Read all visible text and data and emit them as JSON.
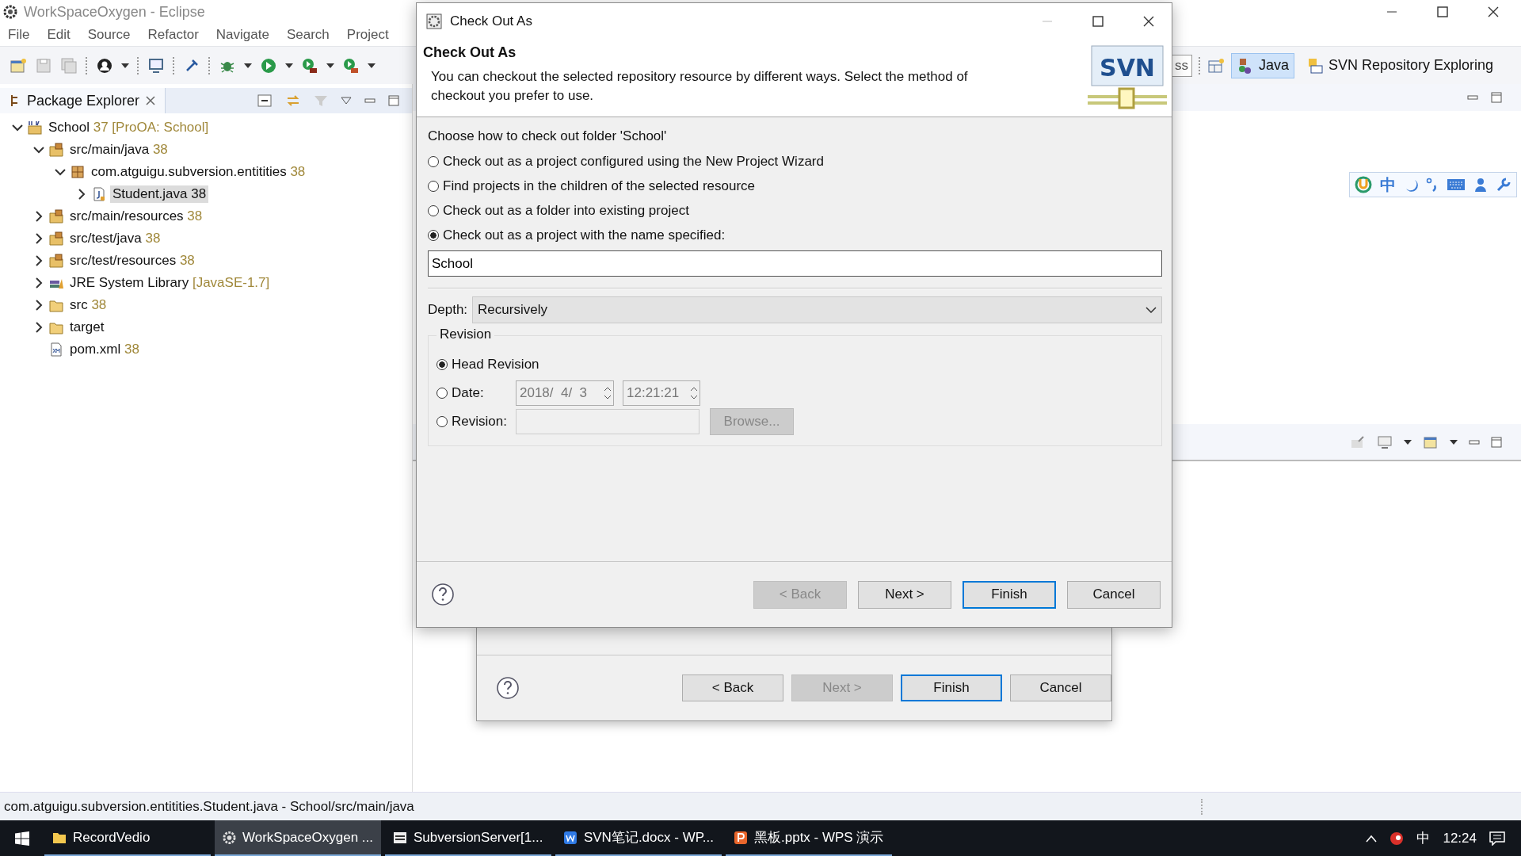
{
  "eclipse": {
    "title": "WorkSpaceOxygen - Eclipse",
    "menu": [
      "File",
      "Edit",
      "Source",
      "Refactor",
      "Navigate",
      "Search",
      "Project"
    ],
    "quick_access": "ss",
    "perspectives": [
      {
        "label": "Java",
        "selected": true,
        "kind": "java"
      },
      {
        "label": "SVN Repository Exploring",
        "selected": false,
        "kind": "svn"
      }
    ],
    "package_explorer": {
      "title": "Package Explorer",
      "tree": [
        {
          "label": "School",
          "decoration": "37 [ProOA: School]",
          "kind": "project",
          "expandable": true,
          "expanded": true,
          "selected": false,
          "children": [
            {
              "label": "src/main/java",
              "decoration": "38",
              "kind": "source-folder",
              "expandable": true,
              "expanded": true,
              "selected": false,
              "children": [
                {
                  "label": "com.atguigu.subversion.entitities",
                  "decoration": "38",
                  "kind": "package",
                  "expandable": true,
                  "expanded": true,
                  "selected": false,
                  "children": [
                    {
                      "label": "Student.java",
                      "decoration": "38",
                      "kind": "java-file",
                      "expandable": true,
                      "expanded": false,
                      "selected": true
                    }
                  ]
                }
              ]
            },
            {
              "label": "src/main/resources",
              "decoration": "38",
              "kind": "source-folder",
              "expandable": true,
              "expanded": false,
              "selected": false
            },
            {
              "label": "src/test/java",
              "decoration": "38",
              "kind": "source-folder",
              "expandable": true,
              "expanded": false,
              "selected": false
            },
            {
              "label": "src/test/resources",
              "decoration": "38",
              "kind": "source-folder",
              "expandable": true,
              "expanded": false,
              "selected": false
            },
            {
              "label": "JRE System Library",
              "decoration": "[JavaSE-1.7]",
              "kind": "library",
              "expandable": true,
              "expanded": false,
              "selected": false
            },
            {
              "label": "src",
              "decoration": "38",
              "kind": "folder",
              "expandable": true,
              "expanded": false,
              "selected": false
            },
            {
              "label": "target",
              "kind": "folder",
              "expandable": true,
              "expanded": false,
              "selected": false
            },
            {
              "label": "pom.xml",
              "decoration": "38",
              "kind": "xml-file",
              "expandable": false,
              "expanded": false,
              "selected": false
            }
          ]
        }
      ]
    },
    "status_bar": "com.atguigu.subversion.entitities.Student.java - School/src/main/java"
  },
  "dialog": {
    "title": "Check Out As",
    "heading": "Check Out As",
    "logo": "SVN",
    "description": "You can checkout the selected repository resource by different ways. Select the method of checkout you prefer to use.",
    "prompt": "Choose how to check out folder 'School'",
    "methods": [
      {
        "label": "Check out as a project configured using the New Project Wizard",
        "selected": false
      },
      {
        "label": "Find projects in the children of the selected resource",
        "selected": false
      },
      {
        "label": "Check out as a folder into existing project",
        "selected": false
      },
      {
        "label": "Check out as a project with the name specified:",
        "selected": true
      }
    ],
    "project_name": "School",
    "depth": {
      "label": "Depth:",
      "value": "Recursively"
    },
    "revision": {
      "title": "Revision",
      "options": [
        {
          "label": "Head Revision",
          "kind": "head",
          "selected": true
        },
        {
          "label": "Date:",
          "kind": "date",
          "selected": false,
          "date": "2018/  4/  3",
          "time": "12:21:21"
        },
        {
          "label": "Revision:",
          "kind": "number",
          "selected": false,
          "button": "Browse..."
        }
      ]
    },
    "buttons": [
      {
        "label": "< Back",
        "disabled": true,
        "default": false
      },
      {
        "label": "Next >",
        "disabled": false,
        "default": false
      },
      {
        "label": "Finish",
        "disabled": false,
        "default": true
      },
      {
        "label": "Cancel",
        "disabled": false,
        "default": false
      }
    ]
  },
  "back_dialog": {
    "buttons": [
      {
        "label": "< Back",
        "disabled": false,
        "default": false
      },
      {
        "label": "Next >",
        "disabled": true,
        "default": false
      },
      {
        "label": "Finish",
        "disabled": false,
        "default": true
      },
      {
        "label": "Cancel",
        "disabled": false,
        "default": false
      }
    ]
  },
  "ime_toolbar": {
    "mode": "中"
  },
  "taskbar": {
    "items": [
      {
        "label": "RecordVedio",
        "kind": "folder",
        "selected": false
      },
      {
        "label": "WorkSpaceOxygen ...",
        "kind": "eclipse",
        "selected": true
      },
      {
        "label": "SubversionServer[1...",
        "kind": "server",
        "selected": false
      },
      {
        "label": "SVN笔记.docx - WP...",
        "kind": "writer",
        "selected": false
      },
      {
        "label": "黑板.pptx - WPS 演示",
        "kind": "presentation",
        "selected": false
      }
    ],
    "ime": "中",
    "clock": "12:24"
  }
}
